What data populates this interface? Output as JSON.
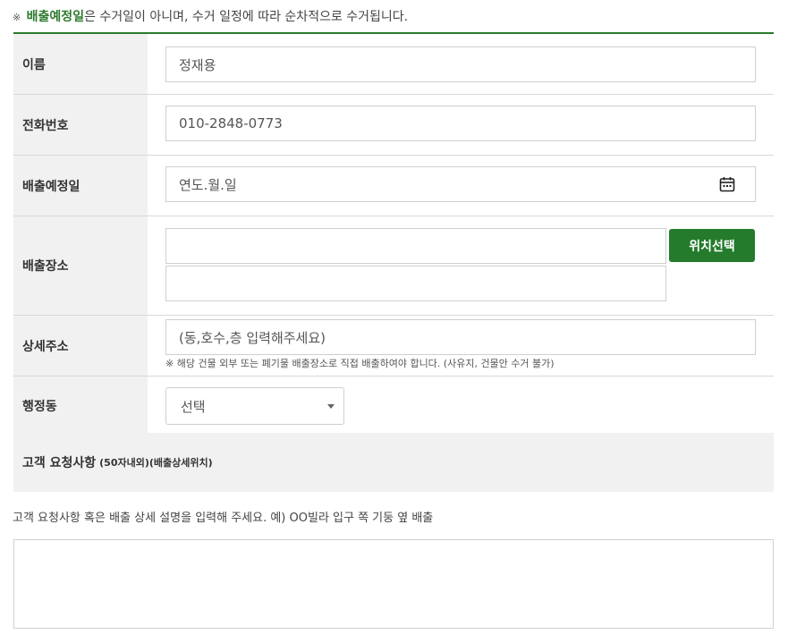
{
  "notice": {
    "mark": "※",
    "highlight": "배출예정일",
    "text": "은 수거일이 아니며, 수거 일정에 따라 순차적으로 수거됩니다."
  },
  "form": {
    "name": {
      "label": "이름",
      "value": "정재용"
    },
    "phone": {
      "label": "전화번호",
      "value": "010-2848-0773"
    },
    "date": {
      "label": "배출예정일",
      "placeholder": "연도.월.일",
      "icon": "calendar-icon"
    },
    "location": {
      "label": "배출장소",
      "value1": "",
      "value2": "",
      "button": "위치선택"
    },
    "detail_address": {
      "label": "상세주소",
      "placeholder": "(동,호수,층 입력해주세요)",
      "hint": "※ 해당 건물 외부 또는 폐기물 배출장소로 직접 배출하여야 합니다. (사유지, 건물안 수거 불가)"
    },
    "district": {
      "label": "행정동",
      "selected": "선택"
    }
  },
  "request": {
    "title": "고객 요청사항",
    "subtitle": "(50자내외)(배출상세위치)",
    "guide": "고객 요청사항 혹은 배출 상세 설명을 입력해 주세요. 예) OO빌라 입구 쪽 기둥 옆 배출",
    "value": ""
  },
  "colors": {
    "accent": "#237b2b",
    "header_bg": "#f1f1f1"
  }
}
